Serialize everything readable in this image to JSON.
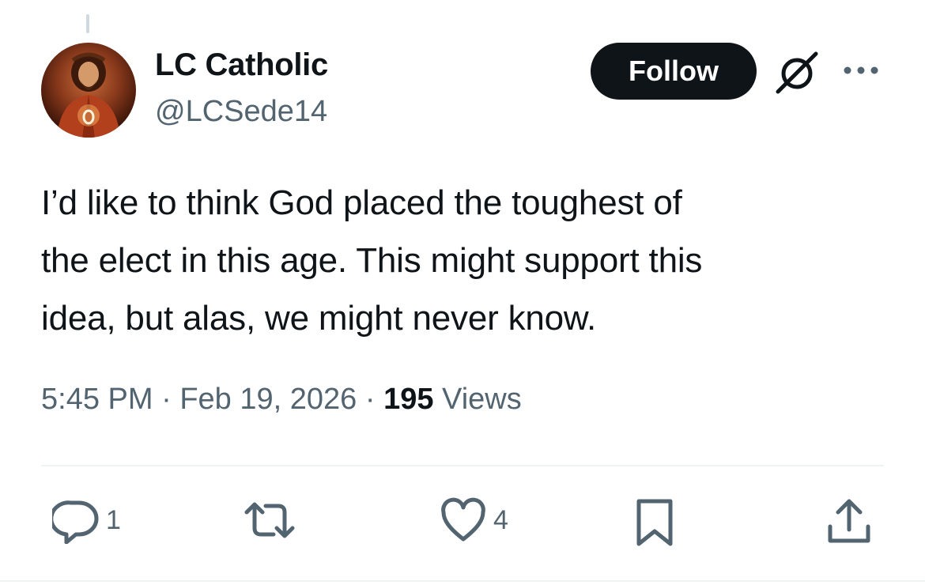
{
  "author": {
    "display_name": "LC Catholic",
    "handle": "@LCSede14",
    "avatar_icon": "avatar-image"
  },
  "follow_label": "Follow",
  "tweet": {
    "lines": [
      "I’d like to think God placed the toughest of",
      "the elect in this age. This might support this",
      "idea, but alas, we might never know."
    ]
  },
  "meta": {
    "time": "5:45 PM",
    "separator": "·",
    "date": "Feb 19, 2026",
    "views_count": "195",
    "views_label": "Views"
  },
  "actions": {
    "reply_count": "1",
    "retweet_count": "",
    "like_count": "4"
  },
  "colors": {
    "text": "#0f1419",
    "secondary": "#536471",
    "button_bg": "#0f1419",
    "divider": "#eff3f4"
  }
}
